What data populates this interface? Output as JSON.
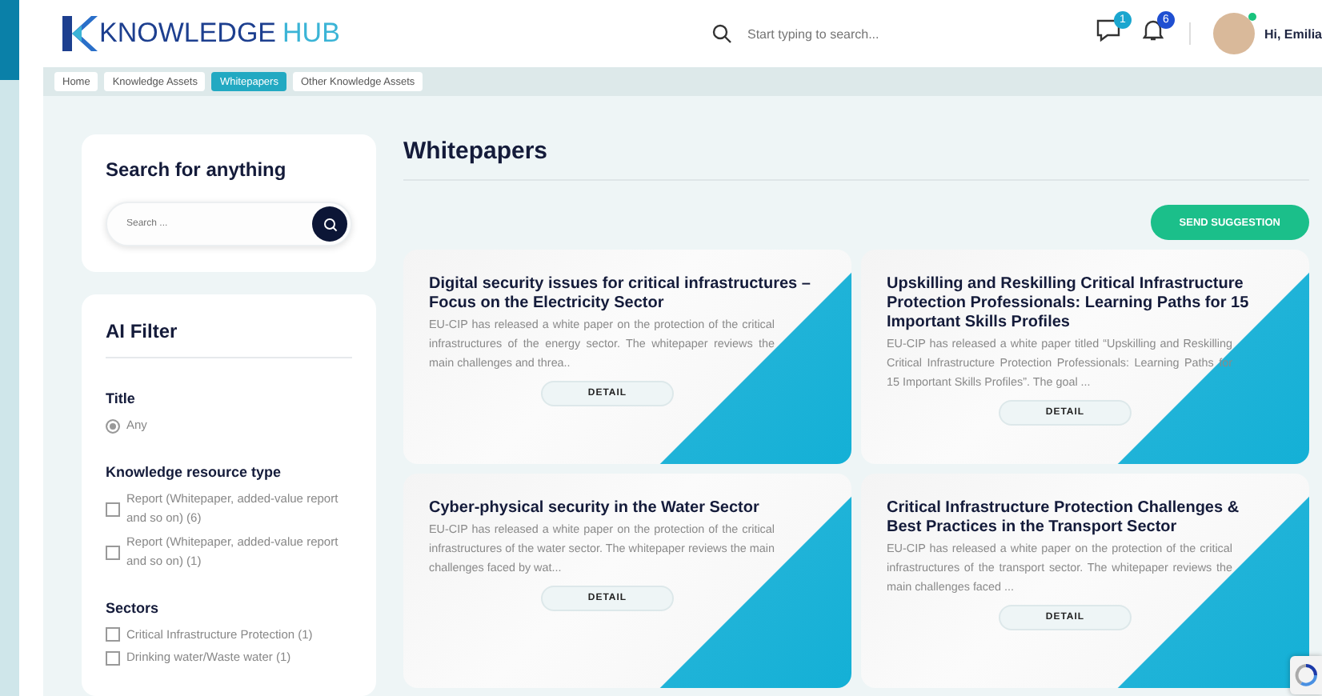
{
  "logo": {
    "text": "KNOWLEDGE",
    "accent": "HUB"
  },
  "header": {
    "search_placeholder": "Start typing to search...",
    "messages_badge": "1",
    "notifications_badge": "6",
    "greeting": "Hi, Emilia",
    "online": true
  },
  "breadcrumbs": [
    {
      "label": "Home",
      "selected": false
    },
    {
      "label": "Knowledge Assets",
      "selected": false
    },
    {
      "label": "Whitepapers",
      "selected": true
    },
    {
      "label": "Other Knowledge Assets",
      "selected": false
    }
  ],
  "search_panel": {
    "title": "Search for anything",
    "placeholder": "Search ..."
  },
  "filter": {
    "title": "AI Filter",
    "groups": [
      {
        "title": "Title",
        "options": [
          {
            "kind": "radio",
            "label": "Any",
            "checked": true
          }
        ]
      },
      {
        "title": "Knowledge resource type",
        "options": [
          {
            "kind": "checkbox",
            "label": "Report (Whitepaper, added-value report and so on) (6)",
            "checked": false
          },
          {
            "kind": "checkbox",
            "label": "Report (Whitepaper, added-value report and so on)  (1)",
            "checked": false
          }
        ]
      },
      {
        "title": "Sectors",
        "options": [
          {
            "kind": "checkbox",
            "label": "Critical Infrastructure Protection (1)",
            "checked": false
          },
          {
            "kind": "checkbox",
            "label": "Drinking water/Waste water (1)",
            "checked": false
          }
        ]
      }
    ]
  },
  "page_title": "Whitepapers",
  "send_button": "SEND SUGGESTION",
  "cards": [
    {
      "title": "Digital security issues for critical infrastructures – Focus on the Electricity Sector",
      "description": "EU-CIP has released a white paper on the protection of the critical infrastructures of the energy sector. The whitepaper reviews the main challenges and threa..",
      "button": "DETAIL"
    },
    {
      "title": "Upskilling and Reskilling Critical Infrastructure Protection Professionals: Learning Paths for 15 Important Skills Profiles",
      "description": "EU-CIP has released a white paper titled “Upskilling and Reskilling Critical Infrastructure Protection Professionals: Learning Paths for 15 Important Skills Profiles”. The goal ...",
      "button": "DETAIL"
    },
    {
      "title": "Cyber-physical security in the Water Sector",
      "description": "EU-CIP has released a white paper on the protection of the critical infrastructures of the water sector. The whitepaper reviews the main challenges faced by wat...",
      "button": "DETAIL"
    },
    {
      "title": "Critical Infrastructure Protection Challenges & Best Practices in the Transport Sector",
      "description": "EU-CIP has released a white paper on the protection of the critical infrastructures of the transport sector. The whitepaper reviews the main challenges faced ...",
      "button": "DETAIL"
    }
  ]
}
